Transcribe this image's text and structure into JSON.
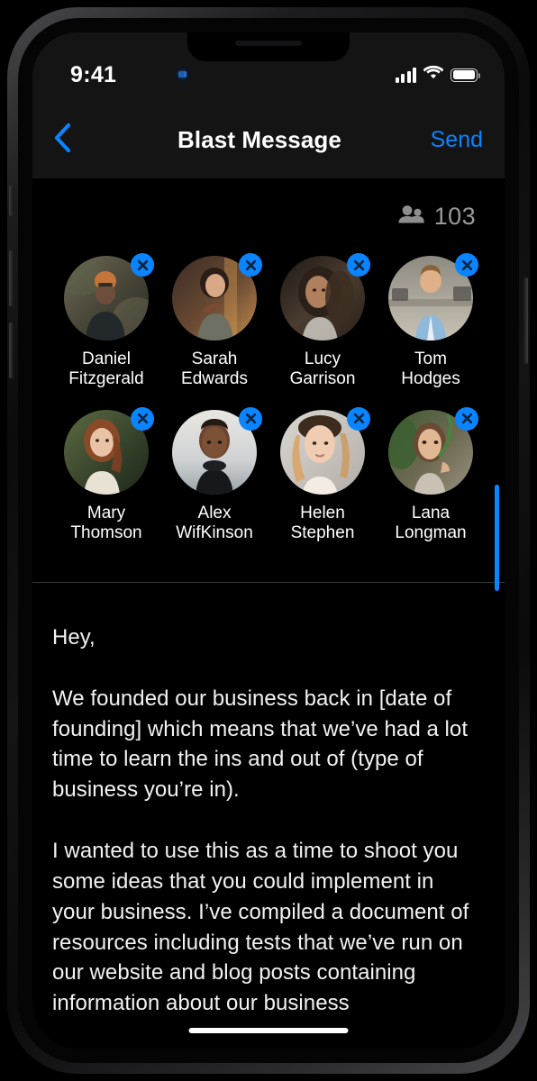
{
  "device": {
    "status_bar": {
      "time": "9:41",
      "signal_icon": "cellular-bars-icon",
      "wifi_icon": "wifi-icon",
      "battery_icon": "battery-full-icon"
    },
    "home_indicator": "home-indicator"
  },
  "nav": {
    "back_icon": "chevron-left-icon",
    "title": "Blast Message",
    "send_label": "Send"
  },
  "recipients": {
    "count_icon": "people-icon",
    "count": "103",
    "remove_icon": "close-x-icon",
    "scrollbar_color": "#0a84ff",
    "people": [
      {
        "first": "Daniel",
        "last": "Fitzgerald",
        "avatar": "man-beanie-outdoors"
      },
      {
        "first": "Sarah",
        "last": "Edwards",
        "avatar": "woman-dark-hair-indoors"
      },
      {
        "first": "Lucy",
        "last": "Garrison",
        "avatar": "woman-curly-hair-portrait"
      },
      {
        "first": "Tom",
        "last": "Hodges",
        "avatar": "man-blue-shirt-office"
      },
      {
        "first": "Mary",
        "last": "Thomson",
        "avatar": "woman-red-hair-sweater"
      },
      {
        "first": "Alex",
        "last": "WifKinson",
        "avatar": "man-turtleneck-portrait"
      },
      {
        "first": "Helen",
        "last": "Stephen",
        "avatar": "woman-blonde-portrait"
      },
      {
        "first": "Lana",
        "last": "Longman",
        "avatar": "woman-leaf-portrait"
      }
    ]
  },
  "message": {
    "paragraphs": [
      "Hey,",
      "We founded our business back in [date of founding] which means that we’ve had a lot time to learn the ins and out of (type of business you’re in).",
      "I wanted to use this as a time to shoot you some ideas that you could implement in your business. I’ve compiled a document of resources including tests that we’ve run on our website and blog posts containing information about our business"
    ]
  },
  "colors": {
    "accent": "#0a84ff",
    "screen_bg": "#000000",
    "bar_bg": "#141414",
    "text": "#ffffff",
    "muted_text": "#9a9a9a"
  }
}
